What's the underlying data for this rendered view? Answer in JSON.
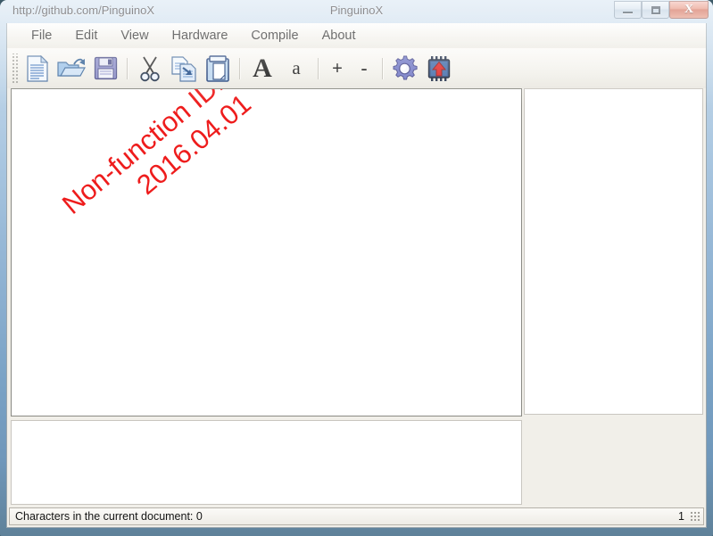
{
  "window": {
    "url_title": "http://github.com/PinguinoX",
    "app_title": "PinguinoX",
    "controls": {
      "minimize": "Minimize",
      "maximize": "Maximize",
      "close": "X"
    }
  },
  "menu": {
    "items": [
      {
        "label": "File",
        "name": "menu-file"
      },
      {
        "label": "Edit",
        "name": "menu-edit"
      },
      {
        "label": "View",
        "name": "menu-view"
      },
      {
        "label": "Hardware",
        "name": "menu-hardware"
      },
      {
        "label": "Compile",
        "name": "menu-compile"
      },
      {
        "label": "About",
        "name": "menu-about"
      }
    ]
  },
  "toolbar": {
    "buttons": [
      {
        "name": "new-file-icon",
        "label": "New"
      },
      {
        "name": "open-folder-icon",
        "label": "Open"
      },
      {
        "name": "save-floppy-icon",
        "label": "Save"
      },
      {
        "name": "cut-scissors-icon",
        "label": "Cut"
      },
      {
        "name": "copy-icon",
        "label": "Copy"
      },
      {
        "name": "paste-clipboard-icon",
        "label": "Paste"
      },
      {
        "name": "font-increase-icon",
        "label": "A"
      },
      {
        "name": "font-decrease-icon",
        "label": "a"
      },
      {
        "name": "zoom-in-icon",
        "label": "+"
      },
      {
        "name": "zoom-out-icon",
        "label": "-"
      },
      {
        "name": "compile-gear-icon",
        "label": "Compile"
      },
      {
        "name": "upload-chip-icon",
        "label": "Upload"
      }
    ],
    "big_a": "A",
    "small_a": "a",
    "plus": "+",
    "minus": "-"
  },
  "editor": {
    "watermark_line1": "Non-function IDE layout",
    "watermark_line2": "2016.04.01",
    "content": ""
  },
  "side_panel": {
    "content": ""
  },
  "bottom_panel": {
    "content": ""
  },
  "statusbar": {
    "left_text": "Characters in the current document: 0",
    "right_text": "1"
  },
  "colors": {
    "watermark": "#ee1c1c",
    "close_button": "#c8492f",
    "titlebar": "#a9c6e0",
    "client": "#f1efe9"
  }
}
